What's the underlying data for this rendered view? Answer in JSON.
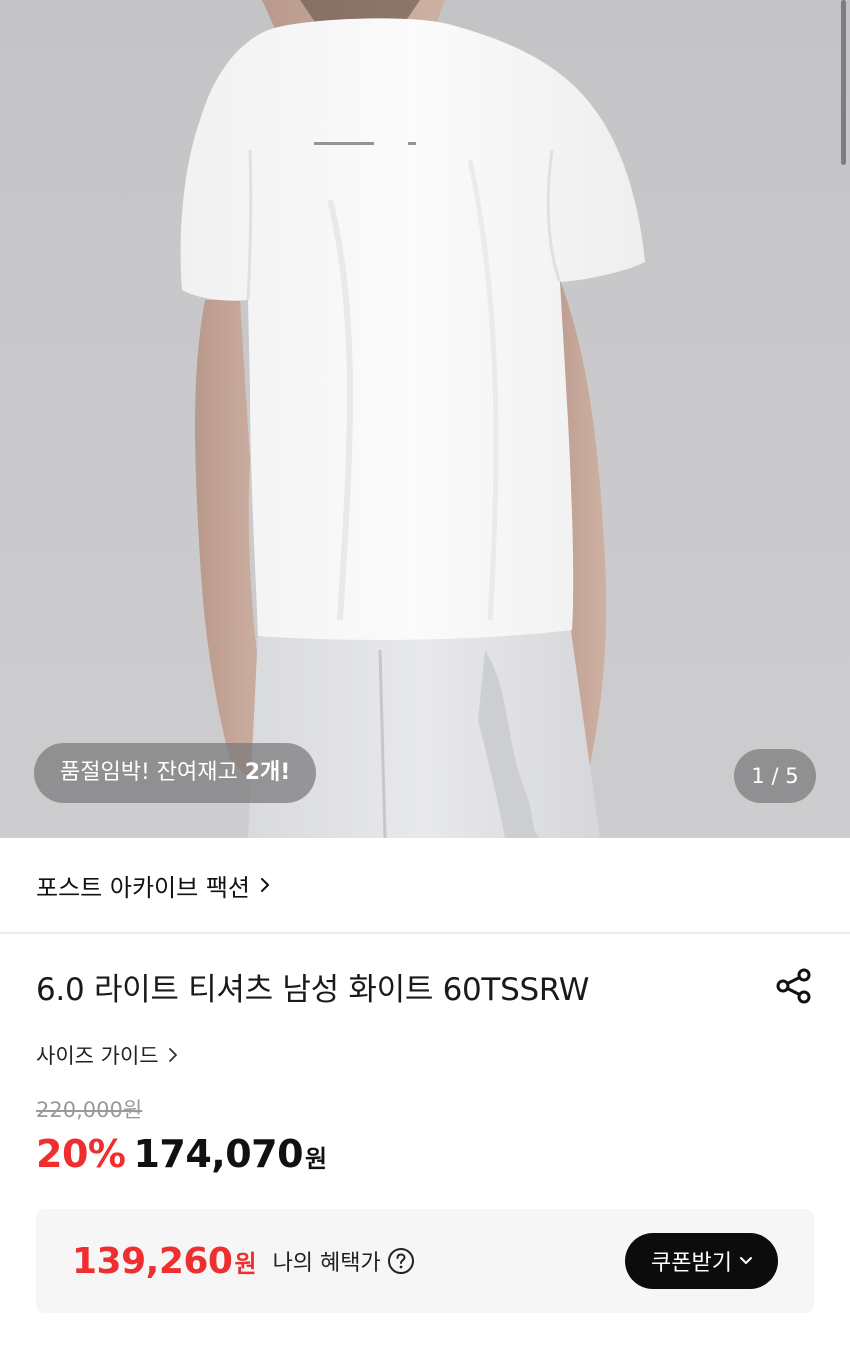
{
  "hero": {
    "stock_badge_prefix": "품절임박! 잔여재고 ",
    "stock_badge_count": "2개!",
    "image_counter": "1 / 5"
  },
  "brand": {
    "name": "포스트 아카이브 팩션",
    "chevron_icon": "chevron-right-icon"
  },
  "product": {
    "title": "6.0 라이트 티셔츠 남성 화이트 60TSSRW",
    "share_icon": "share-icon",
    "size_guide_label": "사이즈 가이드",
    "original_price": "220,000원",
    "discount_rate": "20%",
    "sale_price": "174,070",
    "currency": "원"
  },
  "benefit": {
    "price": "139,260",
    "currency": "원",
    "label": "나의 혜택가",
    "help_icon": "question-circle-icon",
    "coupon_button_label": "쿠폰받기",
    "coupon_button_icon": "chevron-down-icon"
  },
  "colors": {
    "accent_red": "#ef2f2f",
    "button_black": "#0c0c0c",
    "benefit_bg": "#f6f6f6"
  }
}
